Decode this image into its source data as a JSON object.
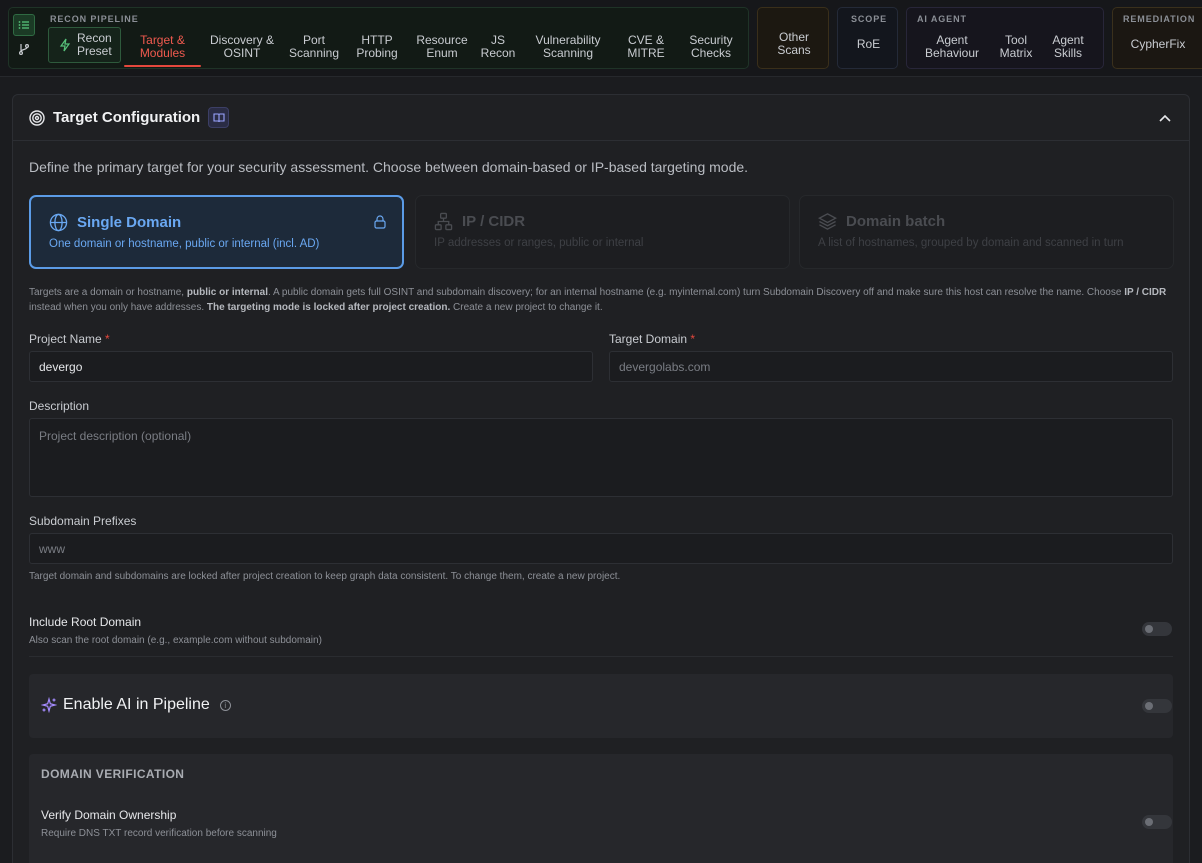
{
  "nav": {
    "recon_group_label": "RECON PIPELINE",
    "preset_label": "Recon\nPreset",
    "items": [
      {
        "label": "Target &\nModules",
        "active": true
      },
      {
        "label": "Discovery &\nOSINT"
      },
      {
        "label": "Port\nScanning"
      },
      {
        "label": "HTTP\nProbing"
      },
      {
        "label": "Resource\nEnum"
      },
      {
        "label": "JS\nRecon"
      },
      {
        "label": "Vulnerability\nScanning"
      },
      {
        "label": "CVE &\nMITRE"
      },
      {
        "label": "Security\nChecks"
      }
    ],
    "other_scans": "Other\nScans",
    "scope_label": "SCOPE",
    "scope_item": "RoE",
    "ai_label": "AI AGENT",
    "ai_items": [
      "Agent\nBehaviour",
      "Tool\nMatrix",
      "Agent\nSkills"
    ],
    "remediation_label": "REMEDIATION",
    "remediation_item": "CypherFix"
  },
  "panel": {
    "title": "Target Configuration",
    "intro": "Define the primary target for your security assessment. Choose between domain-based or IP-based targeting mode."
  },
  "modes": [
    {
      "title": "Single Domain",
      "subtitle": "One domain or hostname, public or internal (incl. AD)"
    },
    {
      "title": "IP / CIDR",
      "subtitle": "IP addresses or ranges, public or internal"
    },
    {
      "title": "Domain batch",
      "subtitle": "A list of hostnames, grouped by domain and scanned in turn"
    }
  ],
  "note": {
    "p1": "Targets are a domain or hostname, ",
    "b1": "public or internal",
    "p2": ". A public domain gets full OSINT and subdomain discovery; for an internal hostname (e.g. myinternal.com) turn Subdomain Discovery off and make sure this host can resolve the name. Choose ",
    "b2": "IP / CIDR",
    "p3": " instead when you only have addresses. ",
    "b3": "The targeting mode is locked after project creation.",
    "p4": " Create a new project to change it."
  },
  "form": {
    "project_name_label": "Project Name",
    "project_name_value": "devergo",
    "target_domain_label": "Target Domain",
    "target_domain_value": "devergolabs.com",
    "required_mark": "*",
    "description_label": "Description",
    "description_placeholder": "Project description (optional)",
    "subdomain_label": "Subdomain Prefixes",
    "subdomain_value": "www",
    "subdomain_hint": "Target domain and subdomains are locked after project creation to keep graph data consistent. To change them, create a new project."
  },
  "root_domain": {
    "title": "Include Root Domain",
    "subtitle": "Also scan the root domain (e.g., example.com without subdomain)"
  },
  "ai": {
    "title": "Enable AI in Pipeline"
  },
  "verification": {
    "heading": "DOMAIN VERIFICATION",
    "title": "Verify Domain Ownership",
    "subtitle": "Require DNS TXT record verification before scanning"
  },
  "colors": {
    "accent_red": "#e5483d",
    "accent_blue": "#5b9be6",
    "recon_green": "#2f6a42"
  }
}
